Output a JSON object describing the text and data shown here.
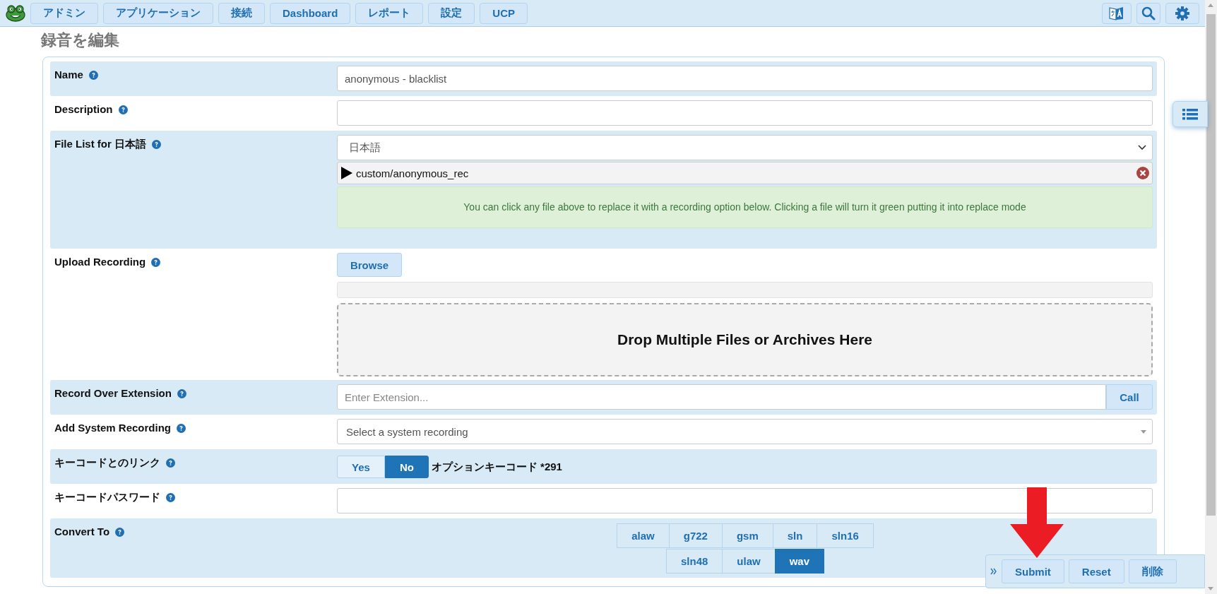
{
  "topbar": {
    "menu": [
      {
        "label": "アドミン"
      },
      {
        "label": "アプリケーション"
      },
      {
        "label": "接続"
      },
      {
        "label": "Dashboard"
      },
      {
        "label": "レポート"
      },
      {
        "label": "設定"
      },
      {
        "label": "UCP"
      }
    ]
  },
  "title": "録音を編集",
  "rows": [
    {
      "kind": "text",
      "label": "Name",
      "value": "anonymous - blacklist"
    },
    {
      "kind": "text",
      "label": "Description"
    },
    {
      "kind": "filelist",
      "label": "File List for 日本語",
      "language": "日本語",
      "files": [
        "custom/anonymous_rec"
      ],
      "notice": "You can click any file above to replace it with a recording option below. Clicking a file will turn it green putting it into replace mode"
    },
    {
      "kind": "upload",
      "label": "Upload Recording",
      "button": "Browse",
      "level": 0,
      "dropzone": "Drop Multiple Files or Archives Here"
    },
    {
      "kind": "extension",
      "label": "Record Over Extension",
      "placeholder": "Enter Extension...",
      "button": "Call"
    },
    {
      "kind": "combo",
      "label": "Add System Recording",
      "placeholder": "Select a system recording"
    },
    {
      "kind": "toggle",
      "label": "キーコードとのリンク",
      "options": [
        {
          "label": "Yes",
          "selected": false
        },
        {
          "label": "No",
          "selected": true
        }
      ],
      "note": "オプションキーコード *291"
    },
    {
      "kind": "text",
      "label": "キーコードパスワード"
    },
    {
      "kind": "formats",
      "label": "Convert To",
      "options": [
        {
          "label": "alaw",
          "selected": false
        },
        {
          "label": "g722",
          "selected": false
        },
        {
          "label": "gsm",
          "selected": false
        },
        {
          "label": "sln",
          "selected": false
        },
        {
          "label": "sln16",
          "selected": false
        },
        {
          "label": "sln48",
          "selected": false
        },
        {
          "label": "ulaw",
          "selected": false
        },
        {
          "label": "wav",
          "selected": true
        }
      ]
    }
  ],
  "actions": {
    "buttons": [
      "Submit",
      "Reset",
      "削除"
    ]
  }
}
